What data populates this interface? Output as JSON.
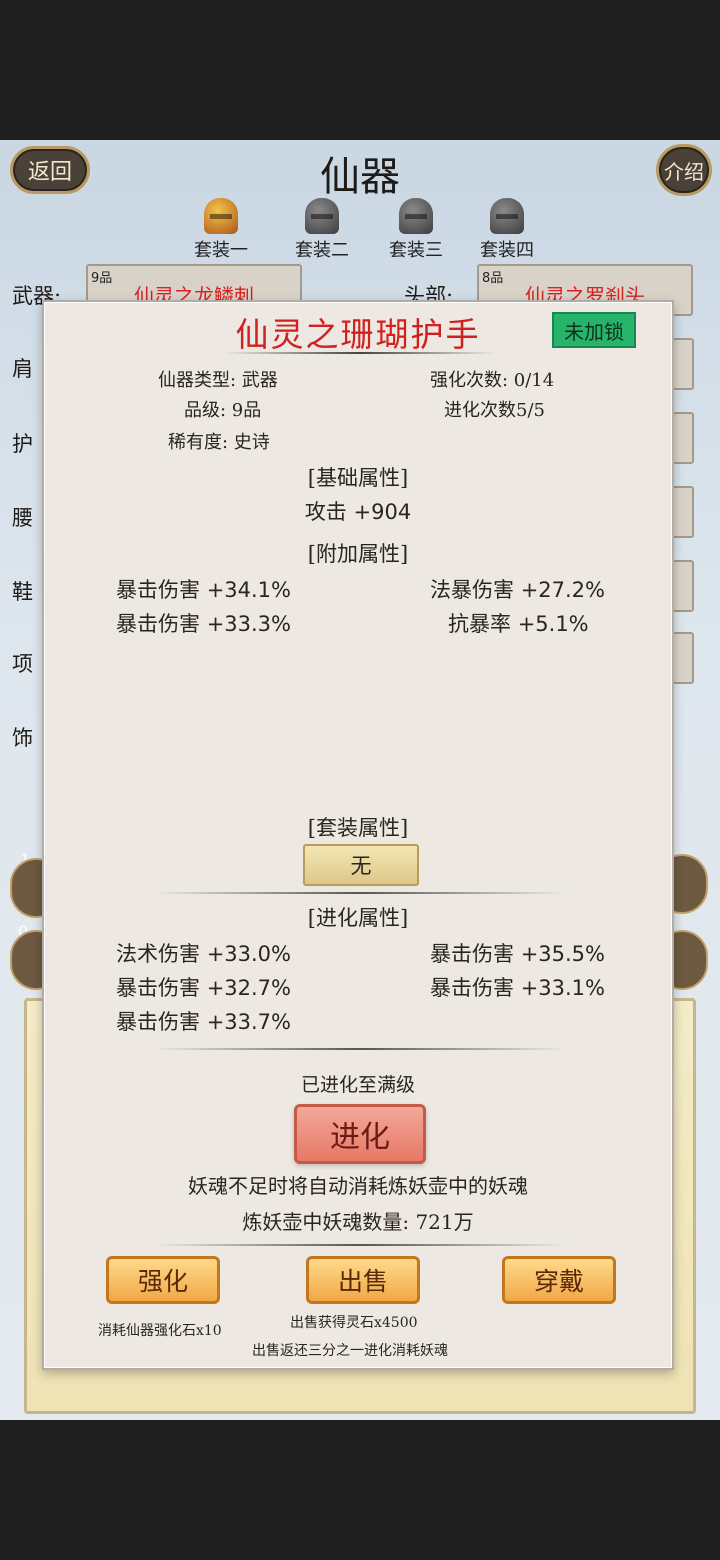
{
  "header": {
    "back": "返回",
    "title": "仙器",
    "intro": "介绍"
  },
  "suits": [
    "套装一",
    "套装二",
    "套装三",
    "套装四"
  ],
  "slots": {
    "weapon": {
      "label": "武器:",
      "tier": "9品",
      "name": "仙灵之龙鳞刺"
    },
    "head": {
      "label": "头部:",
      "tier": "8品",
      "name": "仙灵之罗刹头"
    },
    "partial_labels": [
      "肩",
      "护",
      "腰",
      "鞋",
      "项",
      "饰"
    ]
  },
  "background_fragments": {
    "num1": "1",
    "num2": "0"
  },
  "modal": {
    "title": "仙灵之珊瑚护手",
    "lock": "未加锁",
    "type": "仙器类型: 武器",
    "enhance_count": "强化次数: 0/14",
    "grade": "品级: 9品",
    "evolve_count": "进化次数5/5",
    "rarity": "稀有度: 史诗",
    "base_header": "[基础属性]",
    "base_attack": {
      "name": "攻击",
      "value": "+904"
    },
    "extra_header": "[附加属性]",
    "extra_stats": [
      {
        "name": "暴击伤害",
        "value": "+34.1%"
      },
      {
        "name": "法暴伤害",
        "value": "+27.2%"
      },
      {
        "name": "暴击伤害",
        "value": "+33.3%"
      },
      {
        "name": "抗暴率",
        "value": "+5.1%"
      }
    ],
    "set_header": "[套装属性]",
    "set_value": "无",
    "evo_header": "[进化属性]",
    "evo_stats": [
      {
        "name": "法术伤害",
        "value": "+33.0%"
      },
      {
        "name": "暴击伤害",
        "value": "+35.5%"
      },
      {
        "name": "暴击伤害",
        "value": "+32.7%"
      },
      {
        "name": "暴击伤害",
        "value": "+33.1%"
      },
      {
        "name": "暴击伤害",
        "value": "+33.7%"
      }
    ],
    "max_evolved": "已进化至满级",
    "evolve_button": "进化",
    "auto_note": "妖魂不足时将自动消耗炼妖壶中的妖魂",
    "pot_count": "炼妖壶中妖魂数量: 721万",
    "enhance_button": "强化",
    "sell_button": "出售",
    "equip_button": "穿戴",
    "enhance_cost": "消耗仙器强化石x10",
    "sell_gain": "出售获得灵石x4500",
    "sell_refund": "出售返还三分之一进化消耗妖魂"
  }
}
